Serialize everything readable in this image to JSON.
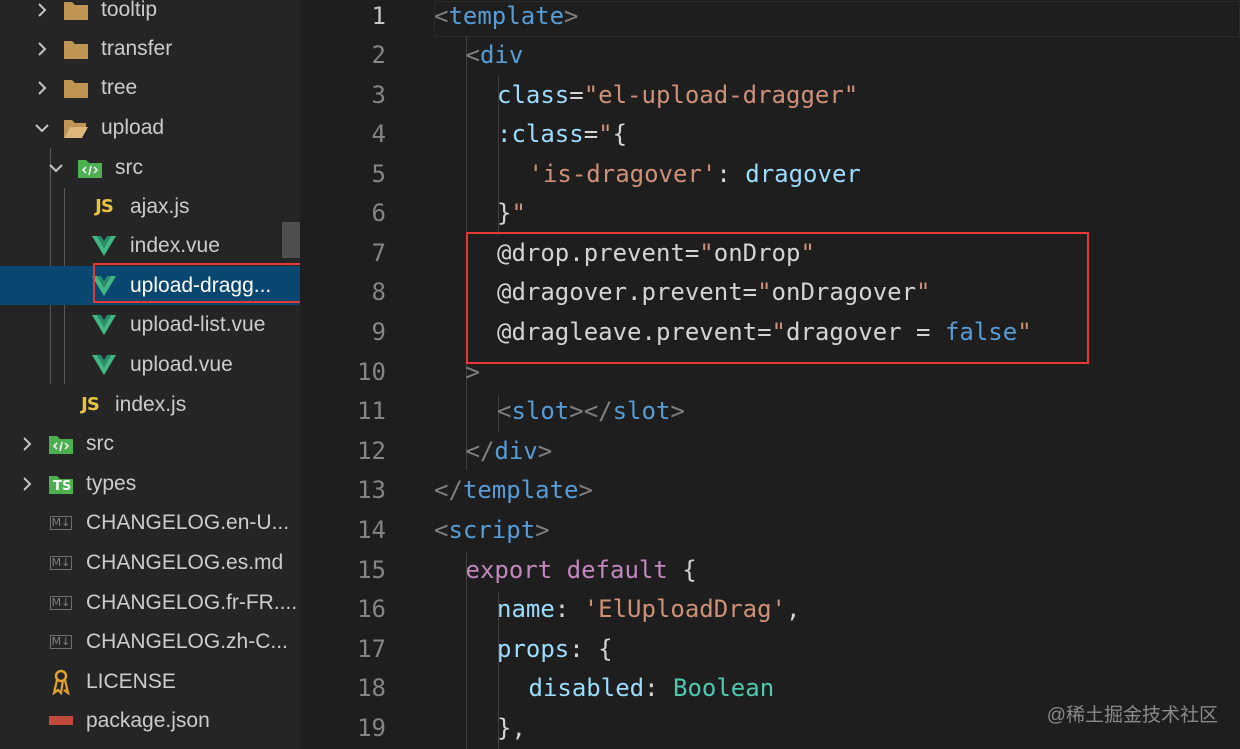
{
  "explorer": {
    "items": [
      {
        "label": "tooltip",
        "icon": "folder-icon",
        "chevron": "right"
      },
      {
        "label": "transfer",
        "icon": "folder-icon",
        "chevron": "right"
      },
      {
        "label": "tree",
        "icon": "folder-icon",
        "chevron": "right"
      },
      {
        "label": "upload",
        "icon": "folder-open-icon",
        "chevron": "down"
      },
      {
        "label": "src",
        "icon": "src-folder-icon",
        "chevron": "down"
      },
      {
        "label": "ajax.js",
        "icon": "js-file-icon",
        "glyph": "JS"
      },
      {
        "label": "index.vue",
        "icon": "vue-file-icon"
      },
      {
        "label": "upload-dragg...",
        "icon": "vue-file-icon",
        "selected": true
      },
      {
        "label": "upload-list.vue",
        "icon": "vue-file-icon"
      },
      {
        "label": "upload.vue",
        "icon": "vue-file-icon"
      },
      {
        "label": "index.js",
        "icon": "js-file-icon",
        "glyph": "JS"
      },
      {
        "label": "src",
        "icon": "src-folder-icon",
        "chevron": "right"
      },
      {
        "label": "types",
        "icon": "ts-folder-icon",
        "chevron": "right",
        "glyph": "TS"
      },
      {
        "label": "CHANGELOG.en-U...",
        "icon": "markdown-file-icon",
        "glyph": "M↓"
      },
      {
        "label": "CHANGELOG.es.md",
        "icon": "markdown-file-icon",
        "glyph": "M↓"
      },
      {
        "label": "CHANGELOG.fr-FR....",
        "icon": "markdown-file-icon",
        "glyph": "M↓"
      },
      {
        "label": "CHANGELOG.zh-C...",
        "icon": "markdown-file-icon",
        "glyph": "M↓"
      },
      {
        "label": "LICENSE",
        "icon": "license-file-icon"
      },
      {
        "label": "package.json",
        "icon": "npm-file-icon"
      }
    ]
  },
  "editor": {
    "line_numbers": [
      "1",
      "2",
      "3",
      "4",
      "5",
      "6",
      "7",
      "8",
      "9",
      "10",
      "11",
      "12",
      "13",
      "14",
      "15",
      "16",
      "17",
      "18",
      "19"
    ],
    "active_line": "1",
    "lines": [
      [
        [
          "tag",
          "<"
        ],
        [
          "tn",
          "template"
        ],
        [
          "tag",
          ">"
        ]
      ],
      [
        [
          "tag",
          "<"
        ],
        [
          "tn",
          "div"
        ]
      ],
      [
        [
          "attr",
          "class"
        ],
        [
          "plain",
          "="
        ],
        [
          "str",
          "\"el-upload-dragger\""
        ]
      ],
      [
        [
          "attr",
          ":class"
        ],
        [
          "plain",
          "="
        ],
        [
          "str",
          "\""
        ],
        [
          "plain",
          "{"
        ]
      ],
      [
        [
          "str",
          "'is-dragover'"
        ],
        [
          "plain",
          ": "
        ],
        [
          "attr",
          "dragover"
        ]
      ],
      [
        [
          "plain",
          "}"
        ],
        [
          "str",
          "\""
        ]
      ],
      [
        [
          "plain",
          "@drop.prevent"
        ],
        [
          "plain",
          "="
        ],
        [
          "str",
          "\""
        ],
        [
          "plain",
          "onDrop"
        ],
        [
          "str",
          "\""
        ]
      ],
      [
        [
          "plain",
          "@dragover.prevent"
        ],
        [
          "plain",
          "="
        ],
        [
          "str",
          "\""
        ],
        [
          "plain",
          "onDragover"
        ],
        [
          "str",
          "\""
        ]
      ],
      [
        [
          "plain",
          "@dragleave.prevent"
        ],
        [
          "plain",
          "="
        ],
        [
          "str",
          "\""
        ],
        [
          "plain",
          "dragover = "
        ],
        [
          "bool",
          "false"
        ],
        [
          "str",
          "\""
        ]
      ],
      [
        [
          "tag",
          ">"
        ]
      ],
      [
        [
          "tag",
          "<"
        ],
        [
          "tn",
          "slot"
        ],
        [
          "tag",
          "></"
        ],
        [
          "tn",
          "slot"
        ],
        [
          "tag",
          ">"
        ]
      ],
      [
        [
          "tag",
          "</"
        ],
        [
          "tn",
          "div"
        ],
        [
          "tag",
          ">"
        ]
      ],
      [
        [
          "tag",
          "</"
        ],
        [
          "tn",
          "template"
        ],
        [
          "tag",
          ">"
        ]
      ],
      [
        [
          "tag",
          "<"
        ],
        [
          "tn",
          "script"
        ],
        [
          "tag",
          ">"
        ]
      ],
      [
        [
          "kw",
          "export default"
        ],
        [
          "plain",
          " {"
        ]
      ],
      [
        [
          "attr",
          "name"
        ],
        [
          "plain",
          ": "
        ],
        [
          "str",
          "'ElUploadDrag'"
        ],
        [
          "plain",
          ","
        ]
      ],
      [
        [
          "attr",
          "props"
        ],
        [
          "plain",
          ": {"
        ]
      ],
      [
        [
          "attr",
          "disabled"
        ],
        [
          "plain",
          ": "
        ],
        [
          "type",
          "Boolean"
        ]
      ],
      [
        [
          "plain",
          "},"
        ]
      ]
    ]
  },
  "watermark": "@稀土掘金技术社区"
}
